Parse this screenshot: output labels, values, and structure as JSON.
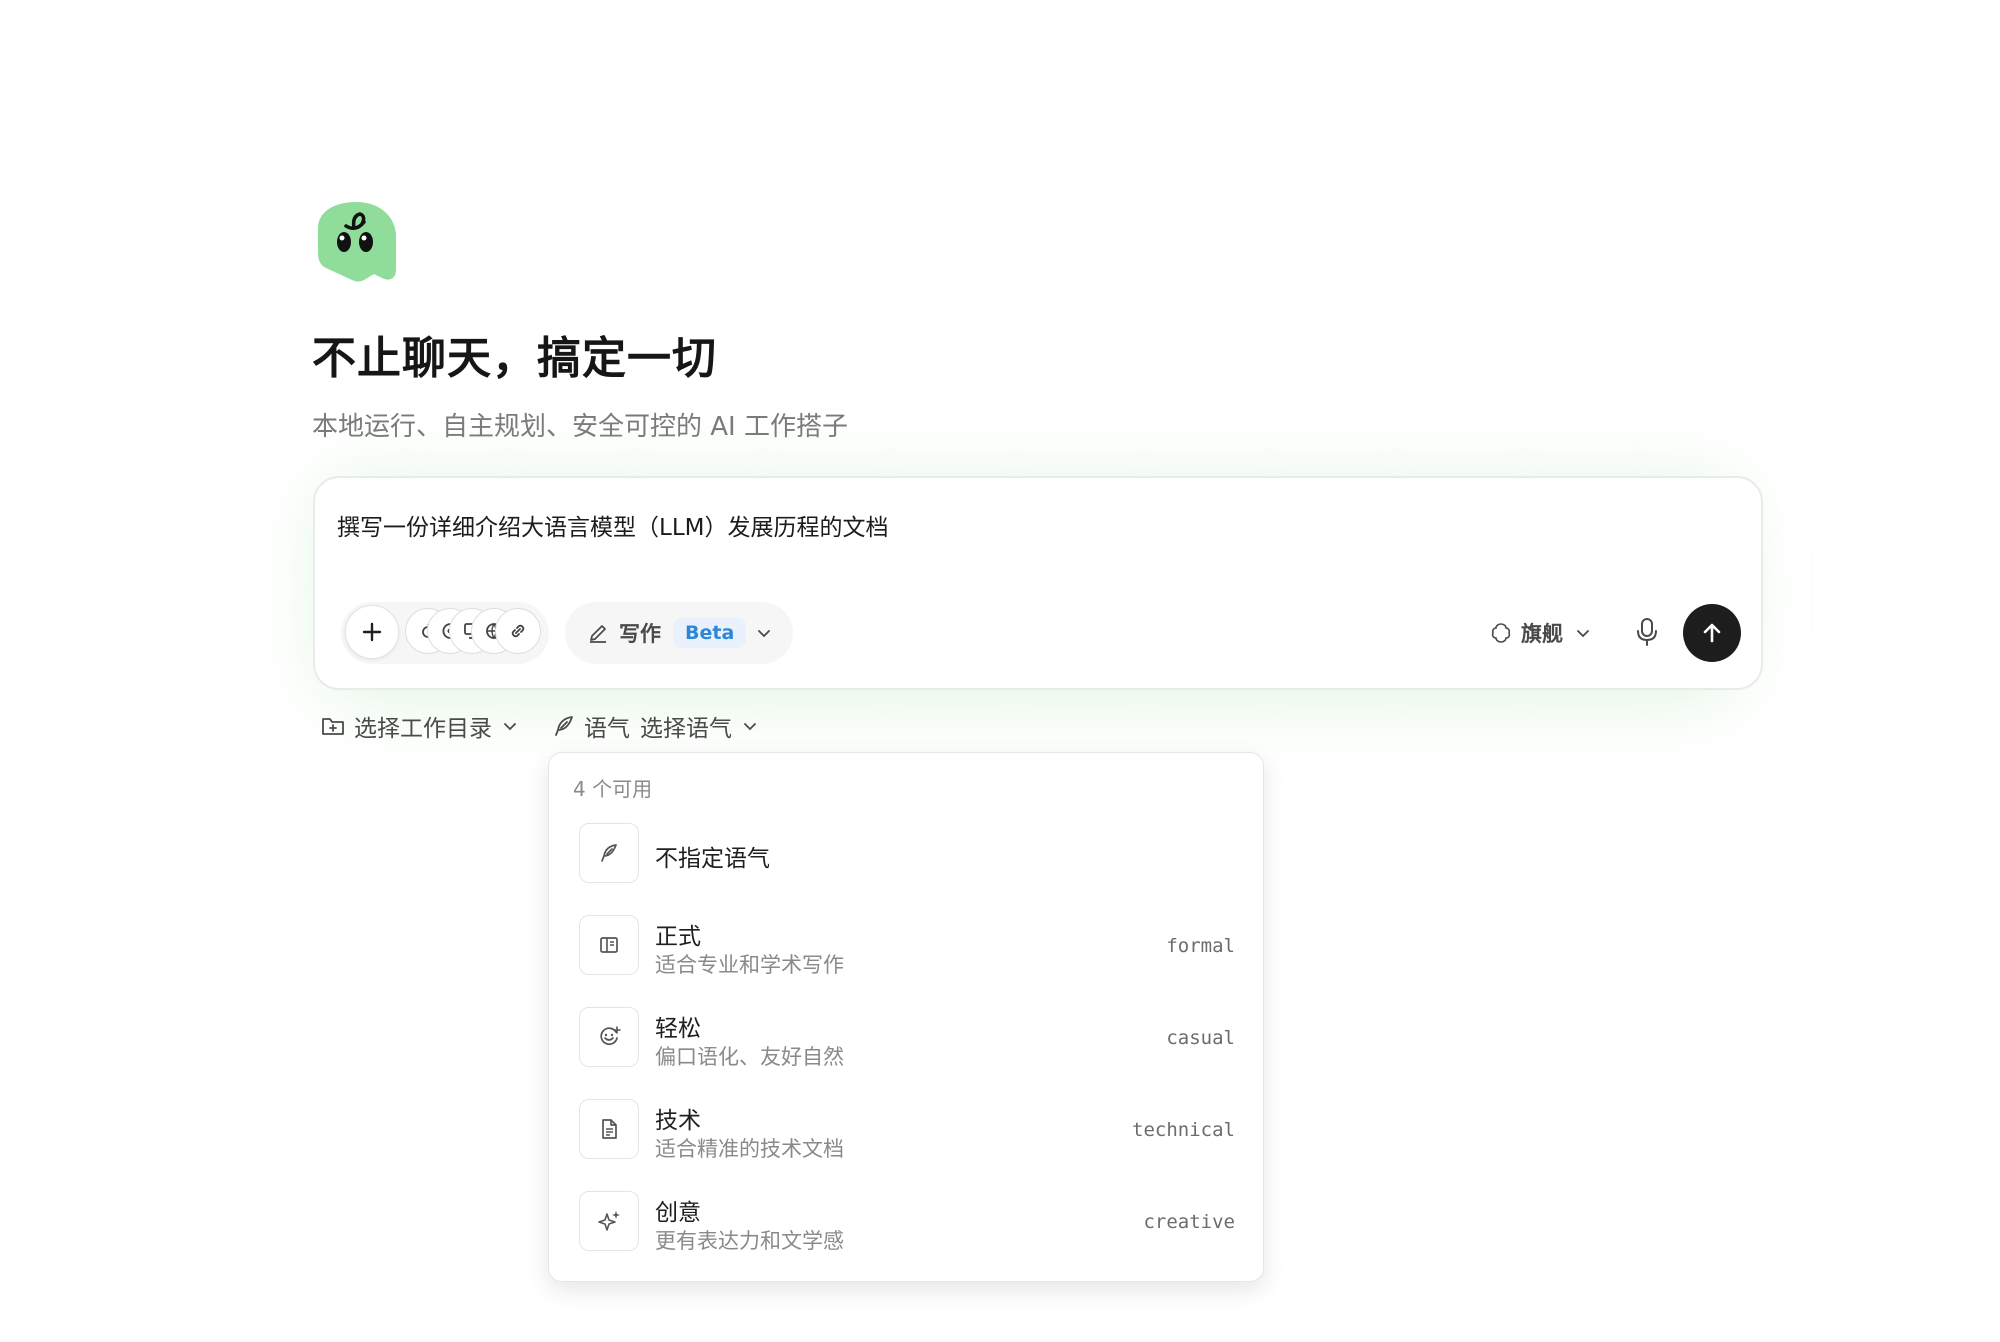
{
  "hero": {
    "title": "不止聊天，搞定一切",
    "subtitle": "本地运行、自主规划、安全可控的 AI 工作搭子"
  },
  "composer": {
    "prompt": "撰写一份详细介绍大语言模型（LLM）发展历程的文档",
    "mode_label": "写作",
    "mode_badge": "Beta",
    "model_label": "旗舰",
    "colors": {
      "send_bg": "#1d1d1d",
      "logo_green": "#8fdc9b",
      "beta_text": "#2f86d8"
    }
  },
  "toolbar": {
    "workdir_label": "选择工作目录",
    "tone_prefix": "语气",
    "tone_label": "选择语气"
  },
  "tone_menu": {
    "header": "4 个可用",
    "items": [
      {
        "title": "不指定语气",
        "desc": "",
        "key": "",
        "icon": "feather-icon"
      },
      {
        "title": "正式",
        "desc": "适合专业和学术写作",
        "key": "formal",
        "icon": "book-icon"
      },
      {
        "title": "轻松",
        "desc": "偏口语化、友好自然",
        "key": "casual",
        "icon": "smile-icon"
      },
      {
        "title": "技术",
        "desc": "适合精准的技术文档",
        "key": "technical",
        "icon": "document-icon"
      },
      {
        "title": "创意",
        "desc": "更有表达力和文学感",
        "key": "creative",
        "icon": "sparkles-icon"
      }
    ]
  }
}
